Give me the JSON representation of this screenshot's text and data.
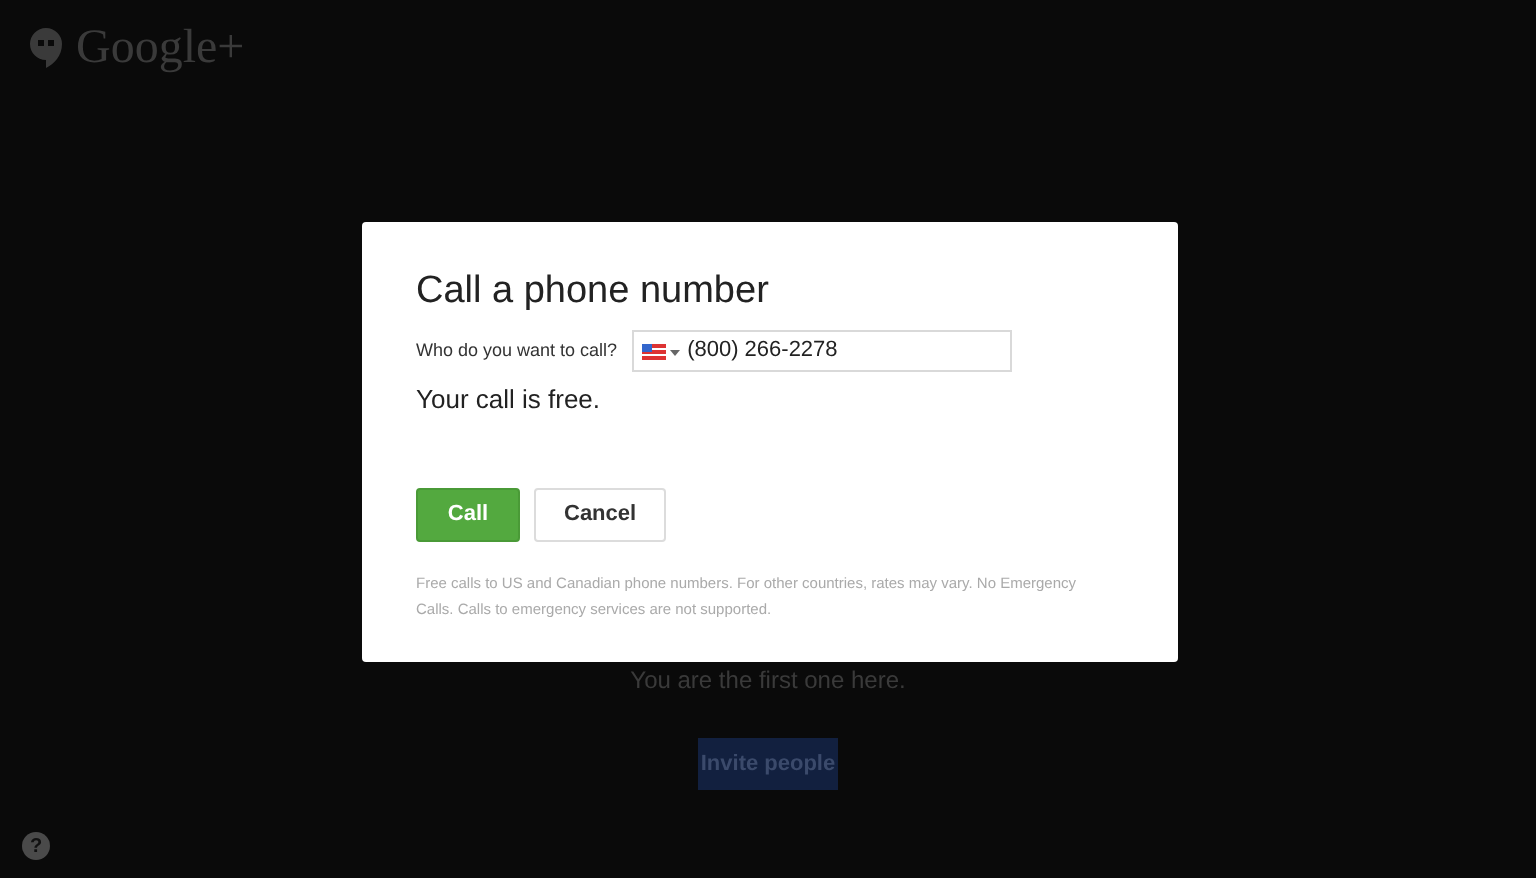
{
  "logo": {
    "text": "Google+"
  },
  "background": {
    "message": "You are the first one here.",
    "invite_button": "Invite people",
    "help": "?"
  },
  "dialog": {
    "title": "Call a phone number",
    "field_label": "Who do you want to call?",
    "phone_value": "(800) 266-2278",
    "status": "Your call is free.",
    "buttons": [
      {
        "label": "Call",
        "kind": "primary"
      },
      {
        "label": "Cancel",
        "kind": "secondary"
      }
    ],
    "note": "Free calls to US and Canadian phone numbers. For other countries, rates may vary. No Emergency Calls. Calls to emergency services are not supported."
  }
}
